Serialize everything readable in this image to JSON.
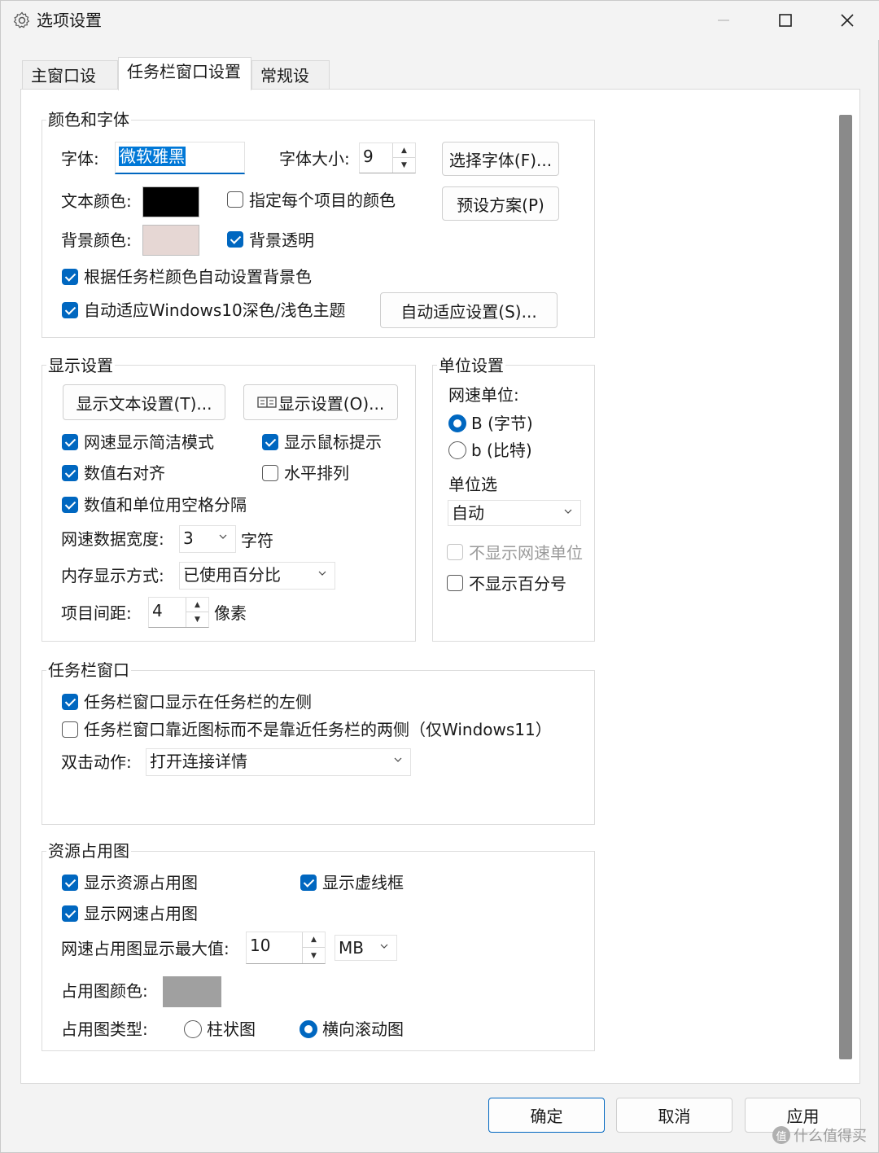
{
  "window": {
    "title": "选项设置"
  },
  "tabs": [
    {
      "label": "主窗口设置"
    },
    {
      "label": "任务栏窗口设置"
    },
    {
      "label": "常规设置"
    }
  ],
  "color_font": {
    "title": "颜色和字体",
    "font_label": "字体:",
    "font_value": "微软雅黑",
    "font_size_label": "字体大小:",
    "font_size_value": "9",
    "choose_font_button": "选择字体(F)...",
    "text_color_label": "文本颜色:",
    "text_color": "#000000",
    "per_item_color": "指定每个项目的颜色",
    "preset_button": "预设方案(P)",
    "bg_color_label": "背景颜色:",
    "bg_color": "#e6d7d4",
    "bg_transparent": "背景透明",
    "auto_bg": "根据任务栏颜色自动设置背景色",
    "auto_theme": "自动适应Windows10深色/浅色主题",
    "auto_adapt_button": "自动适应设置(S)..."
  },
  "display": {
    "title": "显示设置",
    "text_settings_button": "显示文本设置(T)...",
    "display_settings_button": "显示设置(O)...",
    "simple_mode": "网速显示简洁模式",
    "mouse_tip": "显示鼠标提示",
    "right_align": "数值右对齐",
    "horizontal": "水平排列",
    "space_sep": "数值和单位用空格分隔",
    "data_width_label": "网速数据宽度:",
    "data_width_value": "3",
    "chars_unit": "字符",
    "memory_label": "内存显示方式:",
    "memory_value": "已使用百分比",
    "spacing_label": "项目间距:",
    "spacing_value": "4",
    "pixels_unit": "像素"
  },
  "unit": {
    "title": "单位设置",
    "speed_unit_label": "网速单位:",
    "byte_option": "B (字节)",
    "bit_option": "b (比特)",
    "unit_select_label": "单位选",
    "unit_select_value": "自动",
    "hide_speed_unit": "不显示网速单位",
    "hide_percent": "不显示百分号"
  },
  "taskbar": {
    "title": "任务栏窗口",
    "show_left": "任务栏窗口显示在任务栏的左侧",
    "near_icon": "任务栏窗口靠近图标而不是靠近任务栏的两侧（仅Windows11）",
    "dblclick_label": "双击动作:",
    "dblclick_value": "打开连接详情"
  },
  "resource": {
    "title": "资源占用图",
    "show_usage": "显示资源占用图",
    "show_dashed": "显示虚线框",
    "show_speed_graph": "显示网速占用图",
    "max_label": "网速占用图显示最大值:",
    "max_value": "10",
    "max_unit": "MB",
    "graph_color_label": "占用图颜色:",
    "graph_color": "#a0a0a0",
    "graph_type_label": "占用图类型:",
    "bar_option": "柱状图",
    "scroll_option": "横向滚动图"
  },
  "footer": {
    "ok": "确定",
    "cancel": "取消",
    "apply": "应用"
  },
  "watermark": {
    "text": "什么值得买",
    "badge": "值"
  }
}
